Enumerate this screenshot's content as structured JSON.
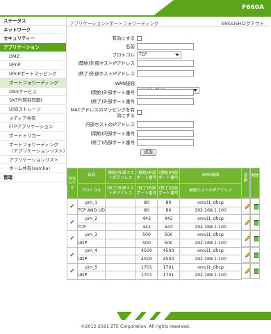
{
  "header": {
    "model": "F660A"
  },
  "breadcrumb": "アプリケーション>ポートフォワーディング",
  "lang_link": "ENGLISHログアウト",
  "sidebar": [
    {
      "label": "ステータス",
      "level": "top"
    },
    {
      "label": "ネットワーク",
      "level": "top"
    },
    {
      "label": "セキュリティー",
      "level": "top"
    },
    {
      "label": "アプリケーション",
      "level": "top",
      "active": true
    },
    {
      "label": "DMZ",
      "level": "sub"
    },
    {
      "label": "UPnP",
      "level": "sub"
    },
    {
      "label": "UPnPポートマッピング",
      "level": "sub"
    },
    {
      "label": "ポートフォワーディング",
      "level": "sub",
      "active": true
    },
    {
      "label": "DNSサービス",
      "level": "sub2"
    },
    {
      "label": "SNTP(時刻同期)",
      "level": "sub2"
    },
    {
      "label": "USBストレージ",
      "level": "sub2"
    },
    {
      "label": "メディア共有",
      "level": "sub2"
    },
    {
      "label": "FTPアプリケーション",
      "level": "sub2"
    },
    {
      "label": "ポートトリガー",
      "level": "sub2"
    },
    {
      "label": "ポートフォワーディング（アプリケーションリスト）",
      "level": "sub2"
    },
    {
      "label": "アプリケーションリスト",
      "level": "sub2"
    },
    {
      "label": "ホーム共有(samba)",
      "level": "sub2"
    },
    {
      "label": "管理",
      "level": "top"
    }
  ],
  "form": {
    "enable_label": "有効にする",
    "name_label": "名前",
    "name_value": "",
    "protocol_label": "プロトコル",
    "protocol_value": "TCP",
    "ext_start_ip_label": "(開始)外部ホストIPアドレス",
    "ext_end_ip_label": "(終了)外部ホストIPアドレス",
    "wan_label": "WAN接続",
    "wan_value": "omci1_dhcp",
    "ext_start_port_label": "(開始)外部ポート番号",
    "ext_end_port_label": "(終了)外部ポート番号",
    "mac_label_1": "MACアドレスのマッピングを有",
    "mac_label_2": "効にする",
    "int_host_ip_label": "内部ホストのIPアドレス",
    "int_start_port_label": "(開始)内部ポート番号",
    "int_end_port_label": "(終了)内部ポート番号",
    "add_button": "追加"
  },
  "table": {
    "headers_top": [
      "有効にする",
      "名前",
      "(開始)外部ホストIPアドレス",
      "(開始)外部ポート番号",
      "(開始)内部ポート番号",
      "WAN接続",
      "変更",
      "削除"
    ],
    "headers_bottom": [
      "プロトコル",
      "(終了)外部ホストIPアドレス",
      "(終了)外部ポート番号",
      "(終了)内部ポート番号",
      "接続ホストのIPアドレス"
    ],
    "check_mark": "✔",
    "rows": [
      {
        "name": "pm_1",
        "protocol": "TCP AND UDP",
        "ext_ip_start": "",
        "ext_ip_end": "",
        "ext_port_start": "80",
        "ext_port_end": "80",
        "int_port_start": "80",
        "int_port_end": "80",
        "wan": "omci1_dhcp",
        "host_ip": "192.168.1.100"
      },
      {
        "name": "pm_2",
        "protocol": "TCP",
        "ext_ip_start": "",
        "ext_ip_end": "",
        "ext_port_start": "443",
        "ext_port_end": "443",
        "int_port_start": "443",
        "int_port_end": "443",
        "wan": "omci1_dhcp",
        "host_ip": "192.168.1.100"
      },
      {
        "name": "pm_3",
        "protocol": "UDP",
        "ext_ip_start": "",
        "ext_ip_end": "",
        "ext_port_start": "500",
        "ext_port_end": "500",
        "int_port_start": "500",
        "int_port_end": "500",
        "wan": "omci1_dhcp",
        "host_ip": "192.168.1.100"
      },
      {
        "name": "pm_4",
        "protocol": "UDP",
        "ext_ip_start": "",
        "ext_ip_end": "",
        "ext_port_start": "4500",
        "ext_port_end": "4500",
        "int_port_start": "4500",
        "int_port_end": "4500",
        "wan": "omci1_dhcp",
        "host_ip": "192.168.1.100"
      },
      {
        "name": "pm_5",
        "protocol": "UDP",
        "ext_ip_start": "",
        "ext_ip_end": "",
        "ext_port_start": "1701",
        "ext_port_end": "1701",
        "int_port_start": "1701",
        "int_port_end": "1701",
        "wan": "omci1_dhcp",
        "host_ip": "192.168.1.100"
      }
    ]
  },
  "footer": {
    "copyright": "©2012-2021 ZTE Corporation. All rights reserved."
  },
  "colors": {
    "brand_green": "#5aa51a",
    "table_header": "#73b632",
    "active_sub": "#dcefcc"
  }
}
